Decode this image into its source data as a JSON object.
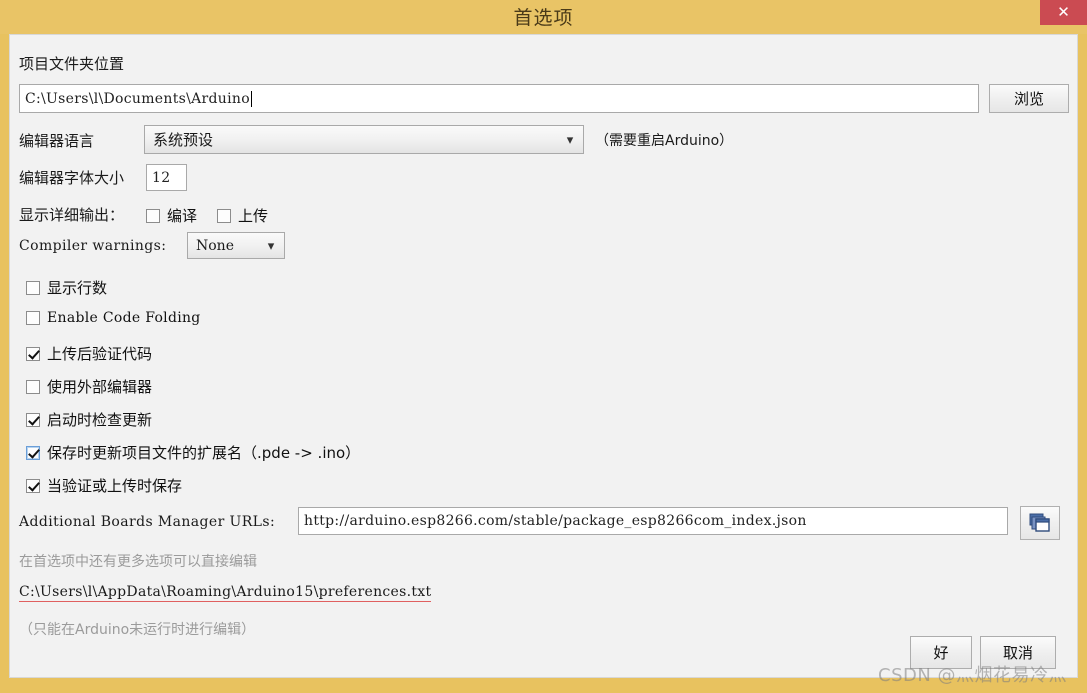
{
  "window": {
    "title": "首选项",
    "close_label": "✕",
    "accent_color": "#e9c466",
    "close_color": "#cb4b52"
  },
  "sketchbook": {
    "label": "项目文件夹位置",
    "path_value": "C:\\Users\\l\\Documents\\Arduino",
    "browse_label": "浏览"
  },
  "language": {
    "label": "编辑器语言",
    "selected": "系统预设",
    "restart_note": "（需要重启Arduino）"
  },
  "fontsize": {
    "label": "编辑器字体大小",
    "value": "12"
  },
  "verbose": {
    "label": "显示详细输出：",
    "compile_label": "编译",
    "compile_checked": false,
    "upload_label": "上传",
    "upload_checked": false
  },
  "warnings": {
    "label": "Compiler warnings:",
    "selected": "None"
  },
  "checkboxes": [
    {
      "label": "显示行数",
      "checked": false,
      "mono": false,
      "focused": false
    },
    {
      "label": "Enable Code Folding",
      "checked": false,
      "mono": true,
      "focused": false
    },
    {
      "label": "上传后验证代码",
      "checked": true,
      "mono": false,
      "focused": false
    },
    {
      "label": "使用外部编辑器",
      "checked": false,
      "mono": false,
      "focused": false
    },
    {
      "label": "启动时检查更新",
      "checked": true,
      "mono": false,
      "focused": false
    },
    {
      "label": "保存时更新项目文件的扩展名（.pde -> .ino）",
      "checked": true,
      "mono": false,
      "focused": true
    },
    {
      "label": "当验证或上传时保存",
      "checked": true,
      "mono": false,
      "focused": false
    }
  ],
  "boards_urls": {
    "label": "Additional Boards Manager URLs:",
    "value": "http://arduino.esp8266.com/stable/package_esp8266com_index.json",
    "button_icon": "windows-cascade-icon"
  },
  "footer": {
    "more_prefs_hint": "在首选项中还有更多选项可以直接编辑",
    "prefs_path": "C:\\Users\\l\\AppData\\Roaming\\Arduino15\\preferences.txt",
    "edit_note": "（只能在Arduino未运行时进行编辑）"
  },
  "actions": {
    "ok_label": "好",
    "cancel_label": "取消"
  },
  "watermark": {
    "text": "CSDN @灬烟花易冷灬"
  }
}
